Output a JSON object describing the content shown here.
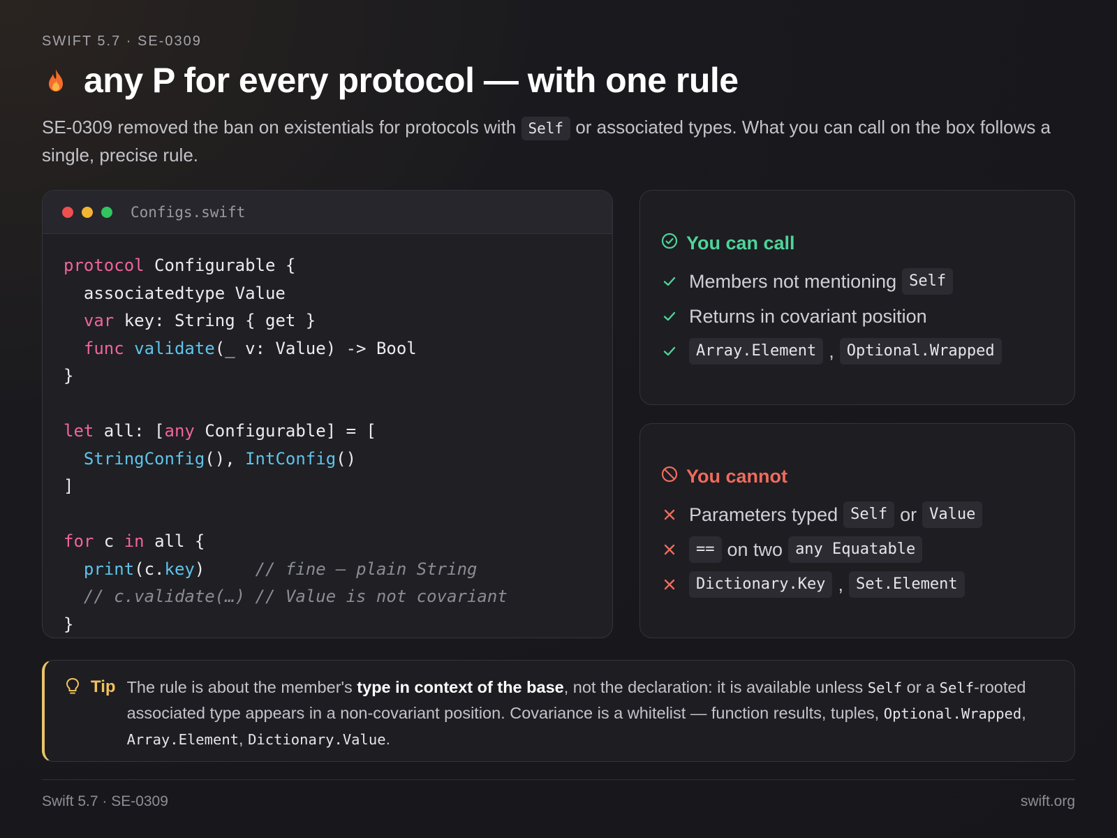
{
  "header": {
    "eyebrow": "SWIFT 5.7 · SE-0309",
    "title": "any P for every protocol — with one rule",
    "lede_before": "SE-0309 removed the ban on existentials for protocols with",
    "lede_code": "Self",
    "lede_after": "or associated types. What you can call on the box follows a single, precise rule.",
    "icon": "flame-icon"
  },
  "code_window": {
    "filename": "Configs.swift",
    "lines": [
      [
        {
          "t": "protocol",
          "c": "kw"
        },
        {
          "t": " Configurable {"
        }
      ],
      [
        {
          "t": "  associatedtype Value"
        }
      ],
      [
        {
          "t": "  "
        },
        {
          "t": "var",
          "c": "kw"
        },
        {
          "t": " key: String { get }"
        }
      ],
      [
        {
          "t": "  "
        },
        {
          "t": "func",
          "c": "kw"
        },
        {
          "t": " "
        },
        {
          "t": "validate",
          "c": "fn"
        },
        {
          "t": "(_ v: Value) -> Bool"
        }
      ],
      [
        {
          "t": "}"
        }
      ],
      [
        {
          "t": ""
        }
      ],
      [
        {
          "t": "let",
          "c": "kw"
        },
        {
          "t": " all: ["
        },
        {
          "t": "any",
          "c": "kw"
        },
        {
          "t": " Configurable] = ["
        }
      ],
      [
        {
          "t": "  "
        },
        {
          "t": "StringConfig",
          "c": "fn"
        },
        {
          "t": "(), "
        },
        {
          "t": "IntConfig",
          "c": "fn"
        },
        {
          "t": "()"
        }
      ],
      [
        {
          "t": "]"
        }
      ],
      [
        {
          "t": ""
        }
      ],
      [
        {
          "t": "for",
          "c": "kw"
        },
        {
          "t": " c "
        },
        {
          "t": "in",
          "c": "kw"
        },
        {
          "t": " all {"
        }
      ],
      [
        {
          "t": "  "
        },
        {
          "t": "print",
          "c": "fn"
        },
        {
          "t": "(c."
        },
        {
          "t": "key",
          "c": "fn"
        },
        {
          "t": ")     "
        },
        {
          "t": "// fine — plain String",
          "c": "cm"
        }
      ],
      [
        {
          "t": "  "
        },
        {
          "t": "// c.validate(…) // Value is not covariant",
          "c": "cm"
        }
      ],
      [
        {
          "t": "}"
        }
      ]
    ]
  },
  "can_panel": {
    "heading": "You can call",
    "icon": "check-circle-icon",
    "items": [
      {
        "parts": [
          {
            "t": "Members not mentioning"
          },
          {
            "t": "Self",
            "code": true
          }
        ]
      },
      {
        "parts": [
          {
            "t": "Returns in covariant position"
          }
        ]
      },
      {
        "parts": [
          {
            "t": "Array.Element",
            "code": true
          },
          {
            "t": ","
          },
          {
            "t": "Optional.Wrapped",
            "code": true
          }
        ]
      }
    ],
    "accent": "#4fd39a"
  },
  "cannot_panel": {
    "heading": "You cannot",
    "icon": "prohibited-icon",
    "items": [
      {
        "parts": [
          {
            "t": "Parameters typed"
          },
          {
            "t": "Self",
            "code": true
          },
          {
            "t": "or"
          },
          {
            "t": "Value",
            "code": true
          }
        ]
      },
      {
        "parts": [
          {
            "t": "==",
            "code": true
          },
          {
            "t": "on two"
          },
          {
            "t": "any Equatable",
            "code": true
          }
        ]
      },
      {
        "parts": [
          {
            "t": "Dictionary.Key",
            "code": true
          },
          {
            "t": ","
          },
          {
            "t": "Set.Element",
            "code": true
          }
        ]
      }
    ],
    "accent": "#f06b5c"
  },
  "tip": {
    "label": "Tip",
    "icon": "lightbulb-icon",
    "t1": "The rule is about the member's ",
    "bold": "type in context of the base",
    "t2": ", not the declaration: it is available unless ",
    "c1": "Self",
    "t3": " or a ",
    "c2": "Self",
    "t4": "-rooted associated type appears in a non-covariant position. Covariance is a whitelist — function results, tuples, ",
    "c3": "Optional.Wrapped",
    "t5": ", ",
    "c4": "Array.Element",
    "t6": ", ",
    "c5": "Dictionary.Value",
    "t7": "."
  },
  "footer": {
    "left": "Swift 5.7 · SE-0309",
    "right": "swift.org"
  }
}
